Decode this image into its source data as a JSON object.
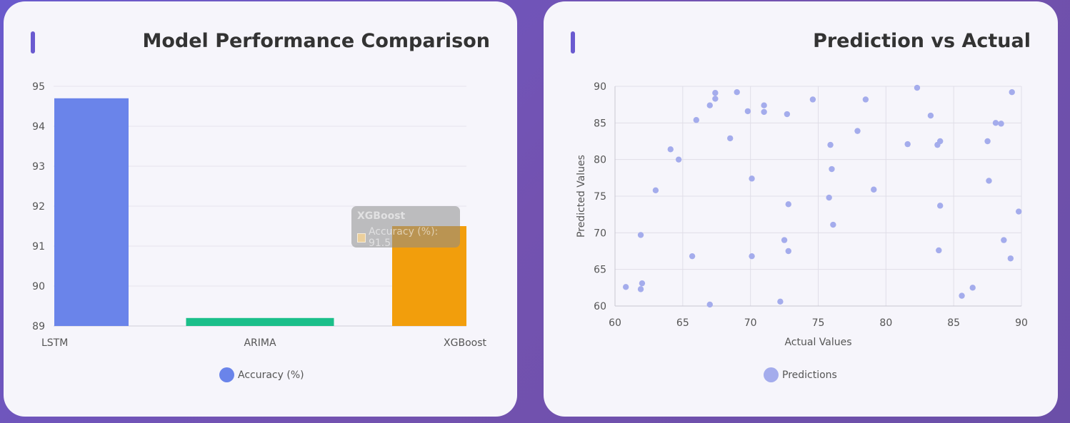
{
  "left_card": {
    "title": "Model Performance Comparison",
    "legend_label": "Accuracy (%)",
    "legend_color": "#6a84ea",
    "tooltip": {
      "title": "XGBoost",
      "line": "Accuracy (%): 91.5"
    }
  },
  "right_card": {
    "title": "Prediction vs Actual",
    "legend_label": "Predictions",
    "legend_color": "#a4acec"
  },
  "chart_data": [
    {
      "type": "bar",
      "categories": [
        "LSTM",
        "ARIMA",
        "XGBoost"
      ],
      "series": [
        {
          "name": "Accuracy (%)",
          "values": [
            94.7,
            89.2,
            91.5
          ]
        }
      ],
      "bar_colors": [
        "#6a84ea",
        "#1bbf8a",
        "#f29e0c"
      ],
      "ylim": [
        89,
        95
      ],
      "yticks": [
        89,
        90,
        91,
        92,
        93,
        94,
        95
      ],
      "grid": true,
      "legend": "bottom"
    },
    {
      "type": "scatter",
      "xlabel": "Actual Values",
      "ylabel": "Predicted Values",
      "xlim": [
        60,
        90
      ],
      "ylim": [
        60,
        90
      ],
      "xticks": [
        60,
        65,
        70,
        75,
        80,
        85,
        90
      ],
      "yticks": [
        60,
        65,
        70,
        75,
        80,
        85,
        90
      ],
      "grid": true,
      "legend": "bottom",
      "series": [
        {
          "name": "Predictions",
          "color": "#a4acec",
          "points": [
            [
              60.8,
              62.6
            ],
            [
              61.9,
              62.3
            ],
            [
              62.0,
              63.1
            ],
            [
              61.9,
              69.7
            ],
            [
              63.0,
              75.8
            ],
            [
              64.1,
              81.4
            ],
            [
              64.7,
              80.0
            ],
            [
              65.7,
              66.8
            ],
            [
              66.0,
              85.4
            ],
            [
              67.0,
              87.4
            ],
            [
              67.4,
              89.1
            ],
            [
              67.4,
              88.3
            ],
            [
              67.0,
              60.2
            ],
            [
              68.5,
              82.9
            ],
            [
              69.0,
              89.2
            ],
            [
              69.8,
              86.6
            ],
            [
              70.1,
              77.4
            ],
            [
              70.1,
              66.8
            ],
            [
              71.0,
              87.4
            ],
            [
              71.0,
              86.5
            ],
            [
              72.5,
              69.0
            ],
            [
              72.8,
              67.5
            ],
            [
              72.8,
              73.9
            ],
            [
              72.7,
              86.2
            ],
            [
              72.2,
              60.6
            ],
            [
              74.6,
              88.2
            ],
            [
              75.8,
              74.8
            ],
            [
              75.9,
              82.0
            ],
            [
              76.0,
              78.7
            ],
            [
              76.1,
              71.1
            ],
            [
              77.9,
              83.9
            ],
            [
              78.5,
              88.2
            ],
            [
              79.1,
              75.9
            ],
            [
              81.6,
              82.1
            ],
            [
              82.3,
              89.8
            ],
            [
              83.3,
              86.0
            ],
            [
              83.8,
              82.0
            ],
            [
              84.0,
              82.5
            ],
            [
              84.0,
              73.7
            ],
            [
              83.9,
              67.6
            ],
            [
              85.6,
              61.4
            ],
            [
              86.4,
              62.5
            ],
            [
              87.5,
              82.5
            ],
            [
              87.6,
              77.1
            ],
            [
              88.1,
              85.0
            ],
            [
              88.5,
              84.9
            ],
            [
              88.7,
              69.0
            ],
            [
              89.2,
              66.5
            ],
            [
              89.3,
              89.2
            ],
            [
              89.8,
              72.9
            ]
          ]
        }
      ]
    }
  ]
}
